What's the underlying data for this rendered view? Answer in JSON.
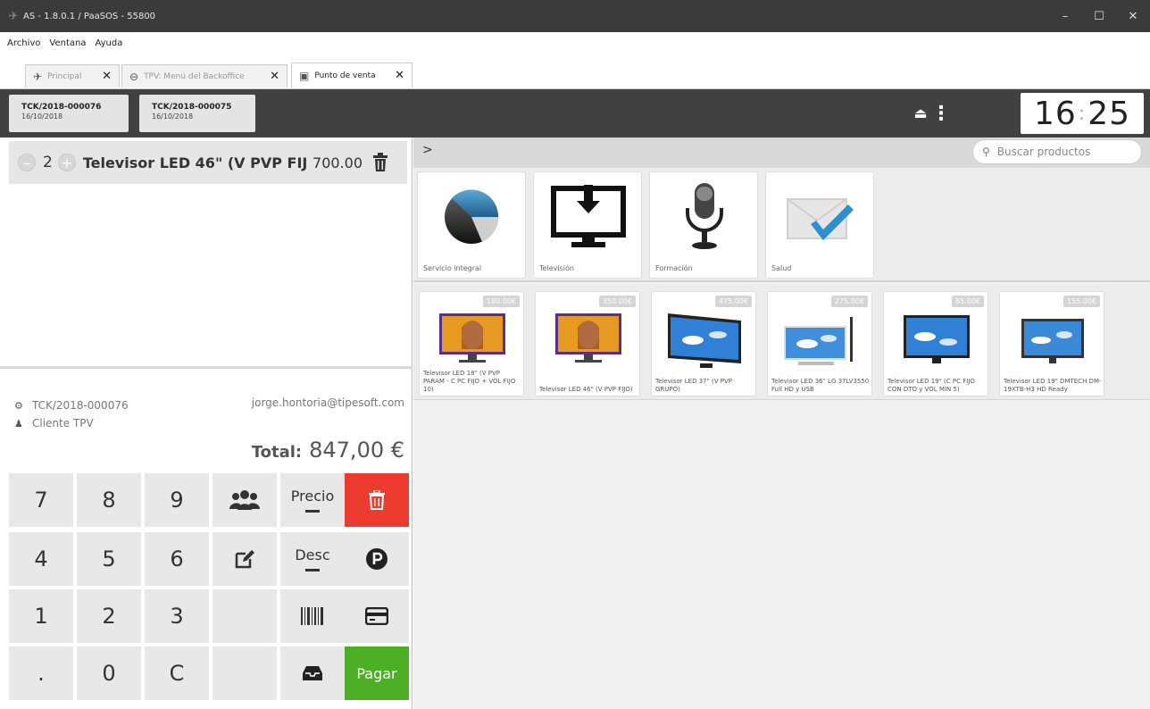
{
  "window": {
    "title": "AS - 1.8.0.1 / PaaSOS - 55800",
    "buttons": [
      "minimize",
      "maximize",
      "close"
    ]
  },
  "menu": [
    "Archivo",
    "Ventana",
    "Ayuda"
  ],
  "tabs": [
    {
      "label": "Principal",
      "icon": "pin-icon",
      "active": false
    },
    {
      "label": "TPV: Menú del Backoffice",
      "icon": "circle-minus-icon",
      "active": false
    },
    {
      "label": "Punto de venta",
      "icon": "window-icon",
      "active": true
    }
  ],
  "tickets": [
    {
      "number": "TCK/2018-000076",
      "date": "16/10/2018"
    },
    {
      "number": "TCK/2018-000075",
      "date": "16/10/2018"
    }
  ],
  "clock": {
    "hours": "16",
    "separator": ":",
    "minutes": "25"
  },
  "order": {
    "lines": [
      {
        "quantity": "2",
        "product": "Televisor LED 46\" (V PVP FIJ",
        "price": "700.00"
      }
    ],
    "ticket": "TCK/2018-000076",
    "customer": "Cliente TPV",
    "user_email": "jorge.hontoria@tipesoft.com",
    "total_label": "Total:",
    "total_value": "847,00 €"
  },
  "keypad": {
    "digits": [
      "7",
      "8",
      "9",
      "4",
      "5",
      "6",
      "1",
      "2",
      "3",
      ".",
      "0",
      "C"
    ],
    "price_label": "Precio",
    "discount_label": "Desc",
    "pay_label": "Pagar",
    "colors": {
      "delete": "#ee3b30",
      "pay": "#4caf26"
    }
  },
  "search": {
    "placeholder": "Buscar productos"
  },
  "categories": [
    {
      "label": "Servicio integral",
      "icon": "pie-chart-icon"
    },
    {
      "label": "Televisión",
      "icon": "monitor-download-icon"
    },
    {
      "label": "Formación",
      "icon": "microphone-icon"
    },
    {
      "label": "Salud",
      "icon": "envelope-check-icon"
    }
  ],
  "products": [
    {
      "name": "Televisor LED 18\" (V PVP PARAM - C PC FIJO + VOL FIJO 10)",
      "price": "180.00€"
    },
    {
      "name": "Televisor LED 46\" (V PVP FIJO)",
      "price": "350.00€"
    },
    {
      "name": "Televisor LED 37\" (V PVP GRUPO)",
      "price": "475.00€"
    },
    {
      "name": "Televisor LED 36\" LG 37LV3550 Full HD y USB",
      "price": "275.00€"
    },
    {
      "name": "Televisor LED 19\" (C PC FIJO CON DTO y VOL MIN 5)",
      "price": "85.00€"
    },
    {
      "name": "Televisor LED 19\" DMTECH DM-19XTB-H3 HD Ready",
      "price": "155.00€"
    }
  ]
}
